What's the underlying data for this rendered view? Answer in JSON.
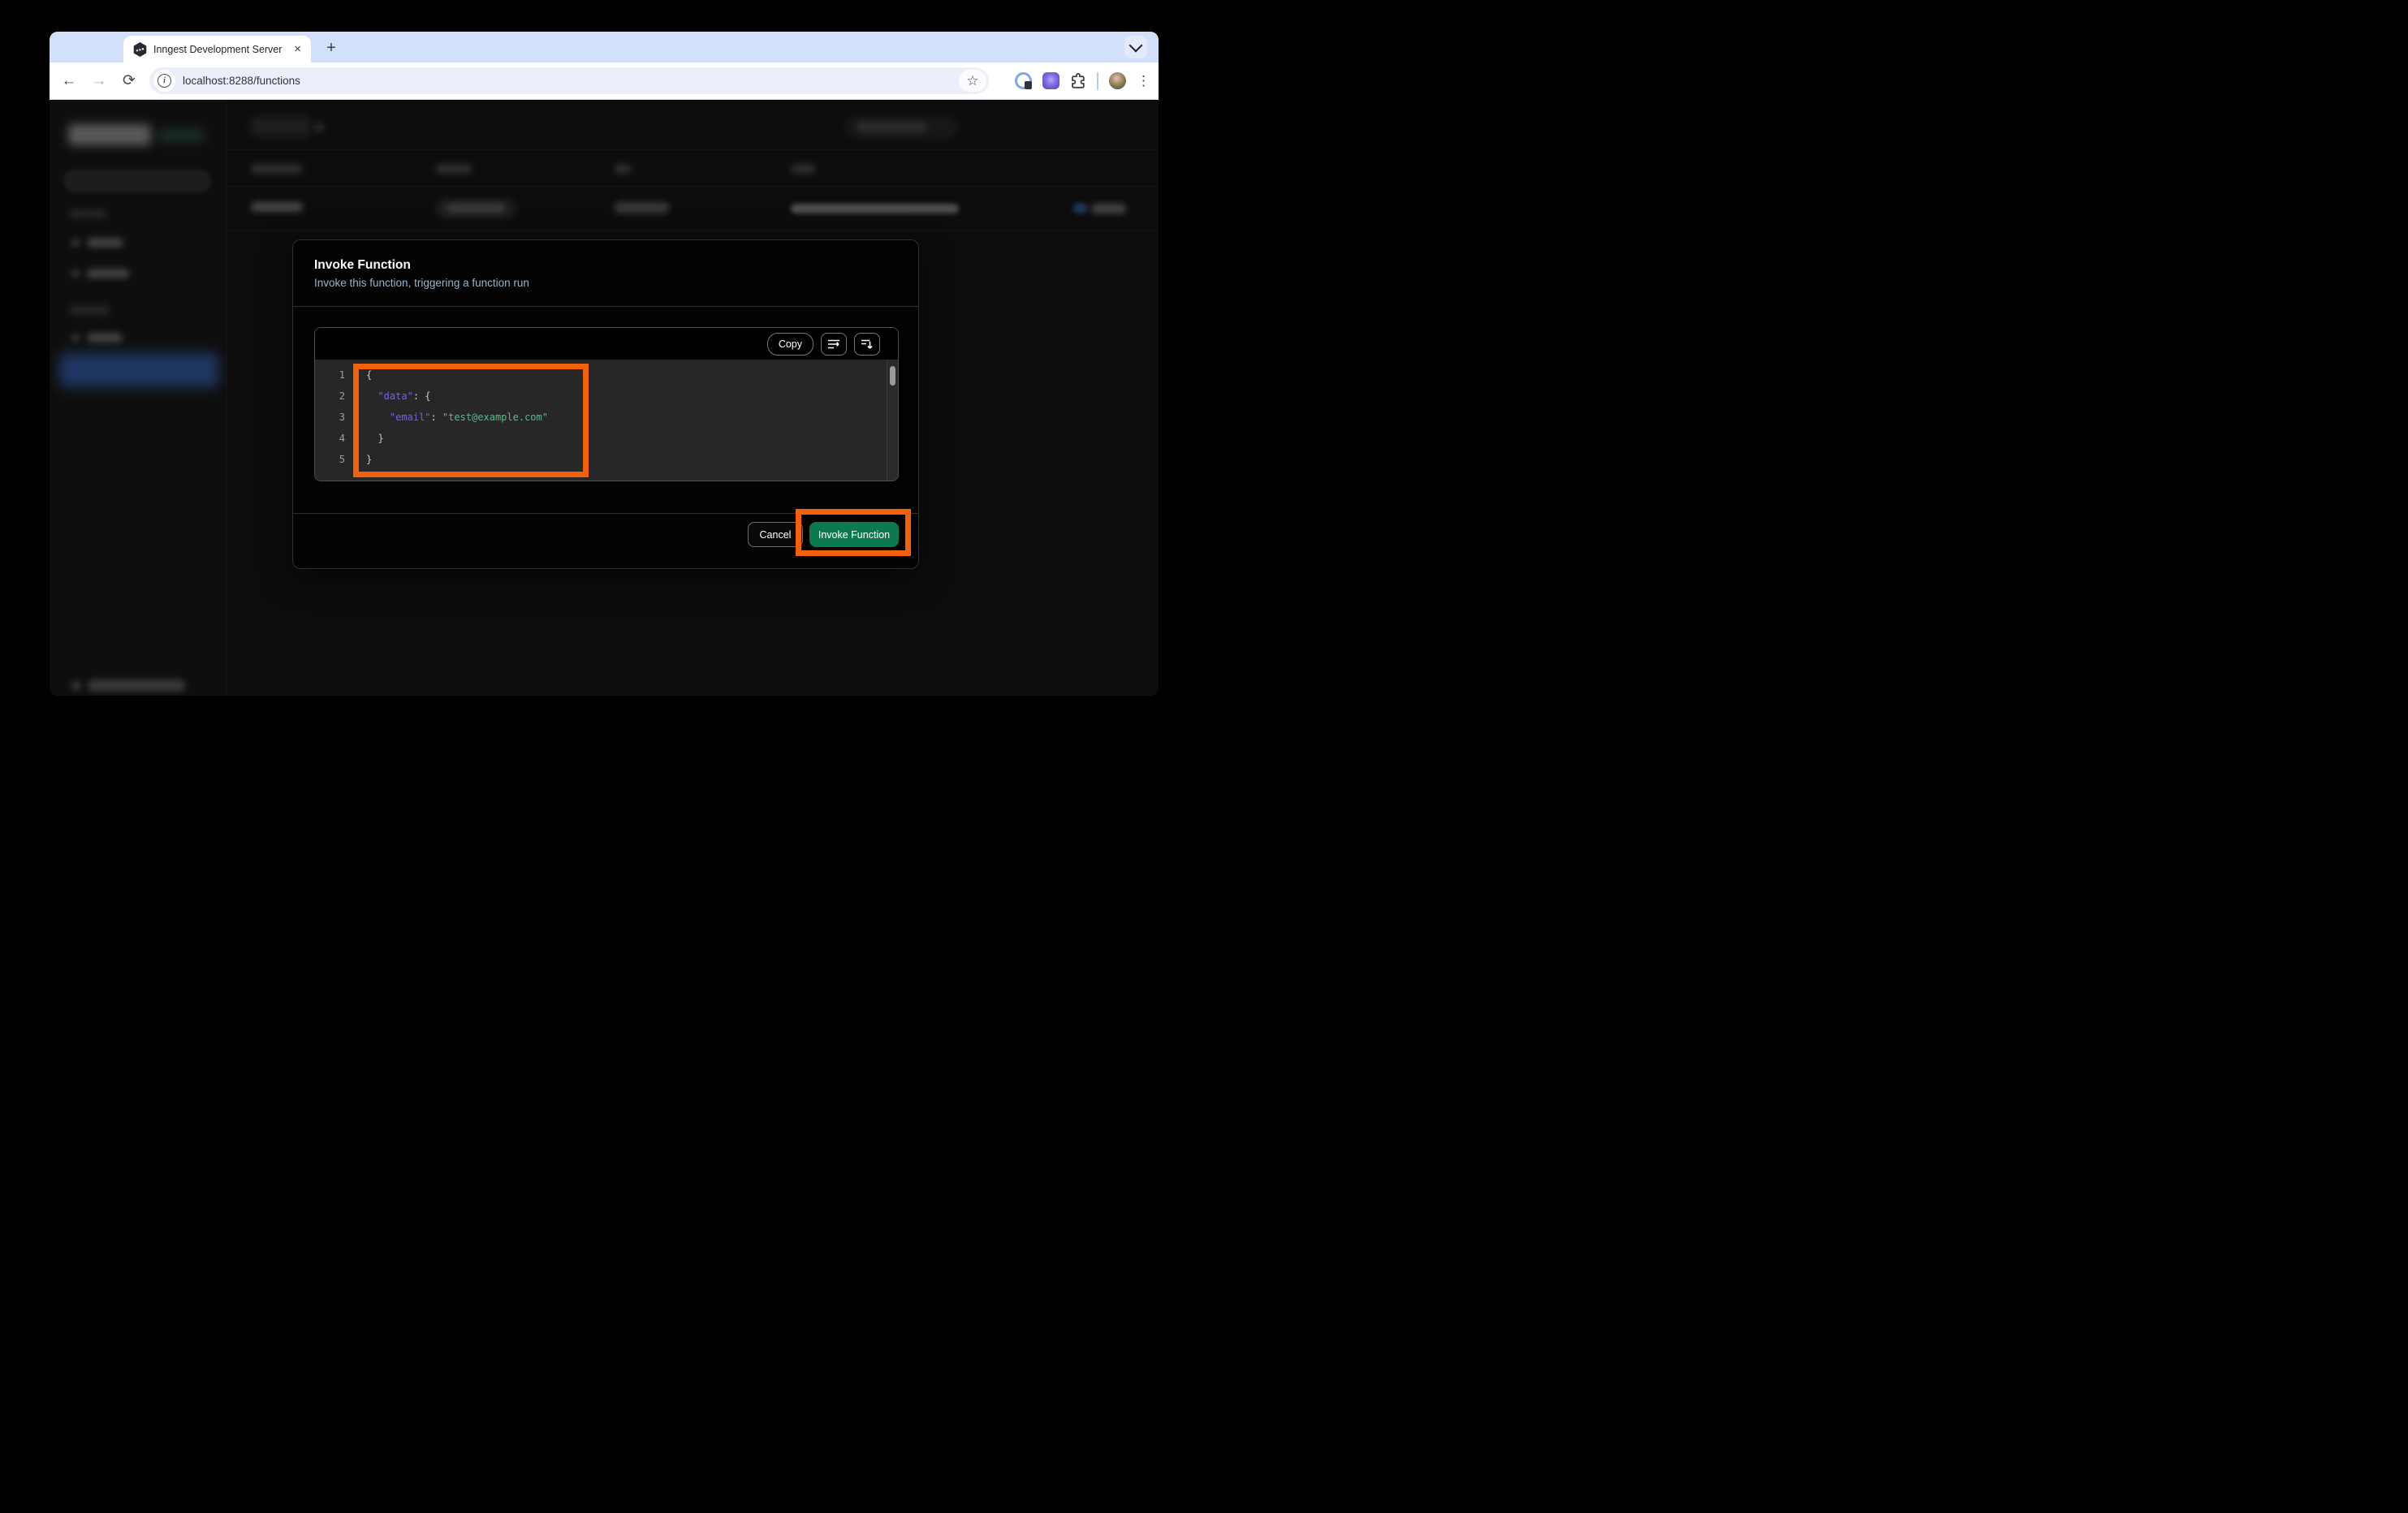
{
  "browser": {
    "tab_title": "Inngest Development Server",
    "tab_close_glyph": "×",
    "new_tab_glyph": "+",
    "back_glyph": "←",
    "forward_glyph": "→",
    "reload_glyph": "⟳",
    "url": "localhost:8288/functions",
    "menu_glyph": "⋮",
    "star_glyph": "☆",
    "info_glyph": "i"
  },
  "modal": {
    "title": "Invoke Function",
    "subtitle": "Invoke this function, triggering a function run",
    "toolbar": {
      "copy_label": "Copy"
    },
    "editor": {
      "line_numbers": [
        "1",
        "2",
        "3",
        "4",
        "5"
      ],
      "lines": [
        [
          {
            "t": "{",
            "c": "plain"
          }
        ],
        [
          {
            "t": "  ",
            "c": "plain"
          },
          {
            "t": "\"data\"",
            "c": "key"
          },
          {
            "t": ": {",
            "c": "plain"
          }
        ],
        [
          {
            "t": "    ",
            "c": "plain"
          },
          {
            "t": "\"email\"",
            "c": "key"
          },
          {
            "t": ": ",
            "c": "plain"
          },
          {
            "t": "\"test@example.com\"",
            "c": "string"
          }
        ],
        [
          {
            "t": "  }",
            "c": "plain"
          }
        ],
        [
          {
            "t": "}",
            "c": "plain"
          }
        ]
      ]
    },
    "footer": {
      "cancel_label": "Cancel",
      "invoke_label": "Invoke Function"
    }
  },
  "colors": {
    "annotation_orange": "#f2600c",
    "invoke_green": "#0b7b4f",
    "code_key_purple": "#7a5bf5",
    "code_string_green": "#55bd8b",
    "chrome_blue": "#d3e0fc",
    "traffic_red": "#ee6a5f",
    "traffic_yellow": "#f5bd4f",
    "traffic_green": "#61c455"
  }
}
